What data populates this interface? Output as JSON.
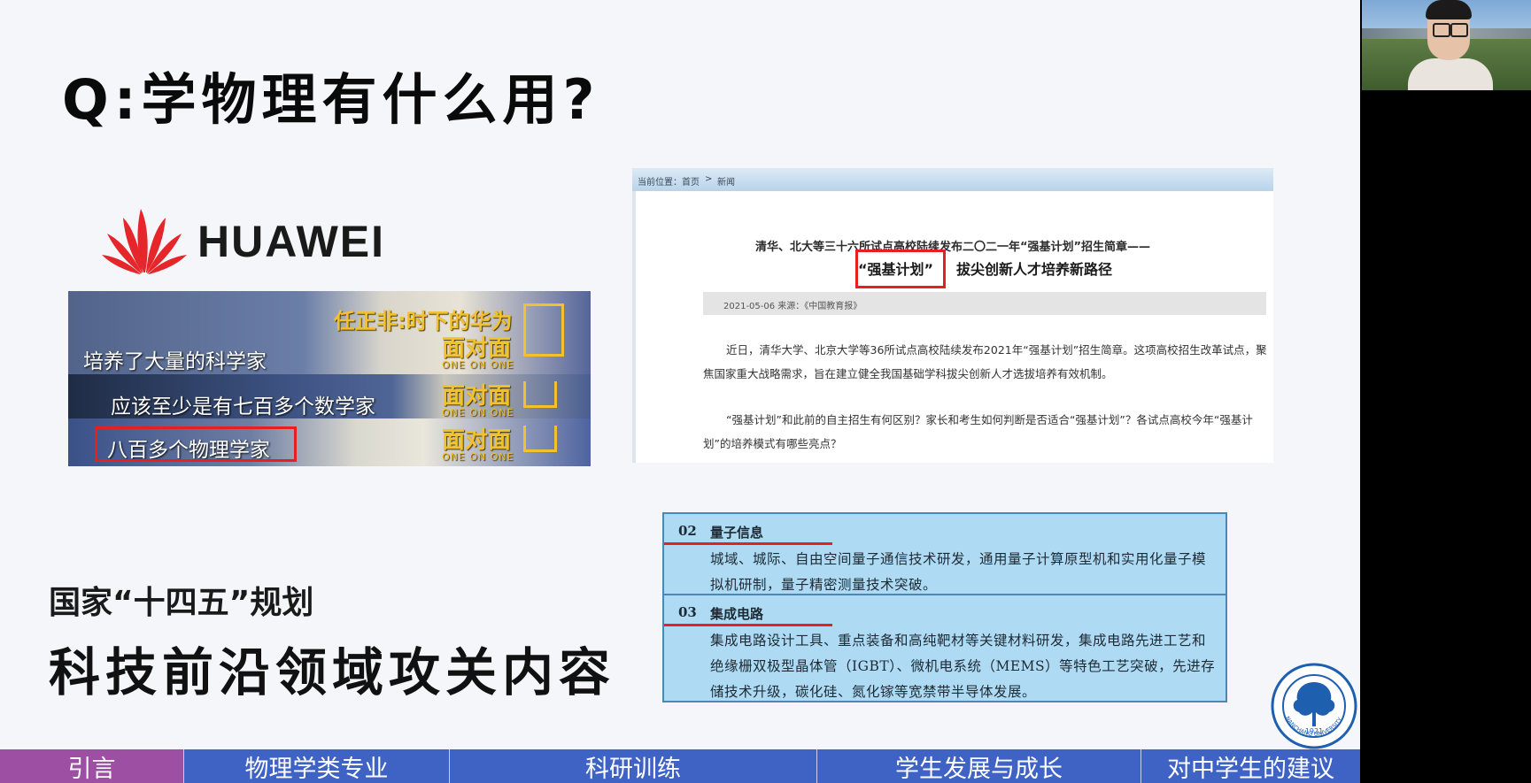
{
  "slide": {
    "title": "Q:学物理有什么用?",
    "huawei_logo_text": "HUAWEI",
    "video": {
      "top_caption": "任正非:时下的华为",
      "brand": "面对面",
      "brand_sub": "ONE ON ONE",
      "subtitle_1": "培养了大量的科学家",
      "subtitle_2": "应该至少是有七百多个数学家",
      "subtitle_3": "八百多个物理学家"
    },
    "news": {
      "breadcrumb": [
        "当前位置：首页",
        ">",
        "新闻"
      ],
      "headline_1": "清华、北大等三十六所试点高校陆续发布二〇二一年“强基计划”招生简章——",
      "headline_2_highlight": "“强基计划”",
      "headline_2_rest": "拔尖创新人才培养新路径",
      "meta": "2021-05-06  来源：《中国教育报》",
      "paragraph_1": "近日，清华大学、北京大学等36所试点高校陆续发布2021年“强基计划”招生简章。这项高校招生改革试点，聚焦国家重大战略需求，旨在建立健全我国基础学科拔尖创新人才选拔培养有效机制。",
      "paragraph_2": "“强基计划”和此前的自主招生有何区别？家长和考生如何判断是否适合“强基计划”？各试点高校今年“强基计划”的培养模式有哪些亮点？"
    },
    "plan": {
      "subtitle": "国家“十四五”规划",
      "heading": "科技前沿领域攻关内容"
    },
    "table": [
      {
        "num": "02",
        "name": "量子信息",
        "text": "城域、城际、自由空间量子通信技术研发，通用量子计算原型机和实用化量子模拟机研制，量子精密测量技术突破。"
      },
      {
        "num": "03",
        "name": "集成电路",
        "text": "集成电路设计工具、重点装备和高纯靶材等关键材料研发，集成电路先进工艺和绝缘栅双极型晶体管（IGBT）、微机电系统（MEMS）等特色工艺突破，先进存储技术升级，碳化硅、氮化镓等宽禁带半导体发展。"
      }
    ],
    "seal_year": "1921",
    "seal_text": "NANCHANG UNIVERSITY"
  },
  "nav": {
    "tabs": [
      "引言",
      "物理学类专业",
      "科研训练",
      "学生发展与成长",
      "对中学生的建议"
    ],
    "active": "引言"
  },
  "colors": {
    "nav_bg": "#3f63c4",
    "nav_active": "#9c4fa3",
    "highlight_red": "#e62020",
    "table_bg": "#aedbf3",
    "brand_gold": "#f2c12e",
    "huawei_red": "#e5262b"
  }
}
